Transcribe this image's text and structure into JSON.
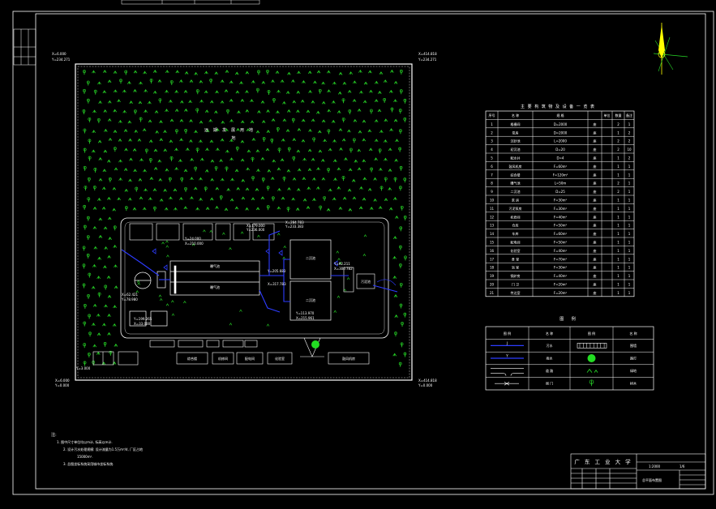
{
  "title_block": {
    "institution": "广 东 工 业 大 学",
    "scale": "1:2000",
    "drawing_no": "1/6",
    "drawing_name": "总平面布置图"
  },
  "notes": {
    "heading": "注:",
    "lines": [
      "1. 图中尺寸单位均以m计, 标高以m计.",
      "2. 设计污水处理规模: 设计流量为1.5万m³/d, 厂区占地",
      "15000m².",
      "3. 总图坐标系统采用城市坐标系统."
    ]
  },
  "site": {
    "reserve_label": "远期发展用地",
    "corner_coords": [
      {
        "x": "X=6.000",
        "y": "Y=234.271"
      },
      {
        "x": "X=414.818",
        "y": "Y=234.271"
      },
      {
        "x": "X=6.000",
        "y": "Y=0.000"
      },
      {
        "x": "X=414.818",
        "y": "Y=0.000"
      }
    ],
    "coords": [
      "X=179.000",
      "Y=236.000",
      "X=284.783",
      "Y=233.383",
      "X=62.421",
      "Y=78.980",
      "X=23.887",
      "X=230.263",
      "Y=205.683",
      "X=317.783",
      "Y=113.970",
      "X=215.961",
      "Y=92.211",
      "X=300.782",
      "Y=199.265",
      "X=33.000",
      "Y=24.000",
      "X=210.000",
      "Y=3.000"
    ],
    "buildings": [
      "初沉池",
      "初沉池",
      "曝气池",
      "曝气池",
      "综合楼",
      "机修间",
      "配电间",
      "化验室",
      "泵房",
      "二沉池",
      "二沉池",
      "污泥池",
      "鼓风机房",
      "仓库",
      "车库"
    ]
  },
  "equipment_table": {
    "title": "主 要 构 筑 物 及 设 备 一 览 表",
    "headers": [
      "序号",
      "名 称",
      "规 格",
      "单位",
      "数量",
      "备注"
    ],
    "rows": [
      [
        "1",
        "格栅间",
        "D=2000",
        "座",
        "2",
        "1"
      ],
      [
        "2",
        "泵房",
        "D=2000",
        "座",
        "1",
        "2"
      ],
      [
        "3",
        "沉砂池",
        "L=2000",
        "座",
        "2",
        "2"
      ],
      [
        "4",
        "初沉池",
        "D=20",
        "座",
        "2",
        "10"
      ],
      [
        "5",
        "配水井",
        "D=4",
        "座",
        "1",
        "2"
      ],
      [
        "6",
        "鼓风机房",
        "F=60m²",
        "座",
        "1",
        "1"
      ],
      [
        "7",
        "综合楼",
        "F=120m²",
        "座",
        "1",
        "1"
      ],
      [
        "8",
        "曝气池",
        "L=50m",
        "座",
        "2",
        "1"
      ],
      [
        "9",
        "二沉池",
        "D=25",
        "座",
        "2",
        "1"
      ],
      [
        "10",
        "泵 房",
        "F=30m²",
        "座",
        "1",
        "1"
      ],
      [
        "11",
        "污泥泵房",
        "F=30m²",
        "座",
        "1",
        "1"
      ],
      [
        "12",
        "机修间",
        "F=40m²",
        "座",
        "1",
        "1"
      ],
      [
        "13",
        "仓库",
        "F=50m²",
        "座",
        "1",
        "1"
      ],
      [
        "14",
        "车库",
        "F=60m²",
        "座",
        "1",
        "1"
      ],
      [
        "15",
        "配电间",
        "F=50m²",
        "座",
        "1",
        "1"
      ],
      [
        "16",
        "化验室",
        "F=40m²",
        "座",
        "1",
        "1"
      ],
      [
        "17",
        "食 堂",
        "F=70m²",
        "座",
        "1",
        "1"
      ],
      [
        "18",
        "浴 室",
        "F=30m²",
        "座",
        "1",
        "1"
      ],
      [
        "19",
        "锅炉房",
        "F=40m²",
        "座",
        "1",
        "1"
      ],
      [
        "20",
        "门 卫",
        "F=20m²",
        "座",
        "1",
        "1"
      ],
      [
        "21",
        "传达室",
        "F=20m²",
        "座",
        "1",
        "1"
      ]
    ]
  },
  "legend": {
    "title": "图 例",
    "headers": [
      "图 例",
      "名 称",
      "图 例",
      "名 称"
    ],
    "rows": [
      [
        "J",
        "污水",
        "",
        "围墙"
      ],
      [
        "Y",
        "雨水",
        "",
        "路灯"
      ],
      [
        "",
        "道 路",
        "",
        "绿地"
      ],
      [
        "",
        "阀 门",
        "",
        "树木"
      ]
    ]
  },
  "colors": {
    "line": "#ffffff",
    "pipe": "#2d3cff",
    "green": "#27d927",
    "yellow": "#ffff00",
    "lamp": "#22dd22",
    "hatch": "#d8d8d8"
  }
}
